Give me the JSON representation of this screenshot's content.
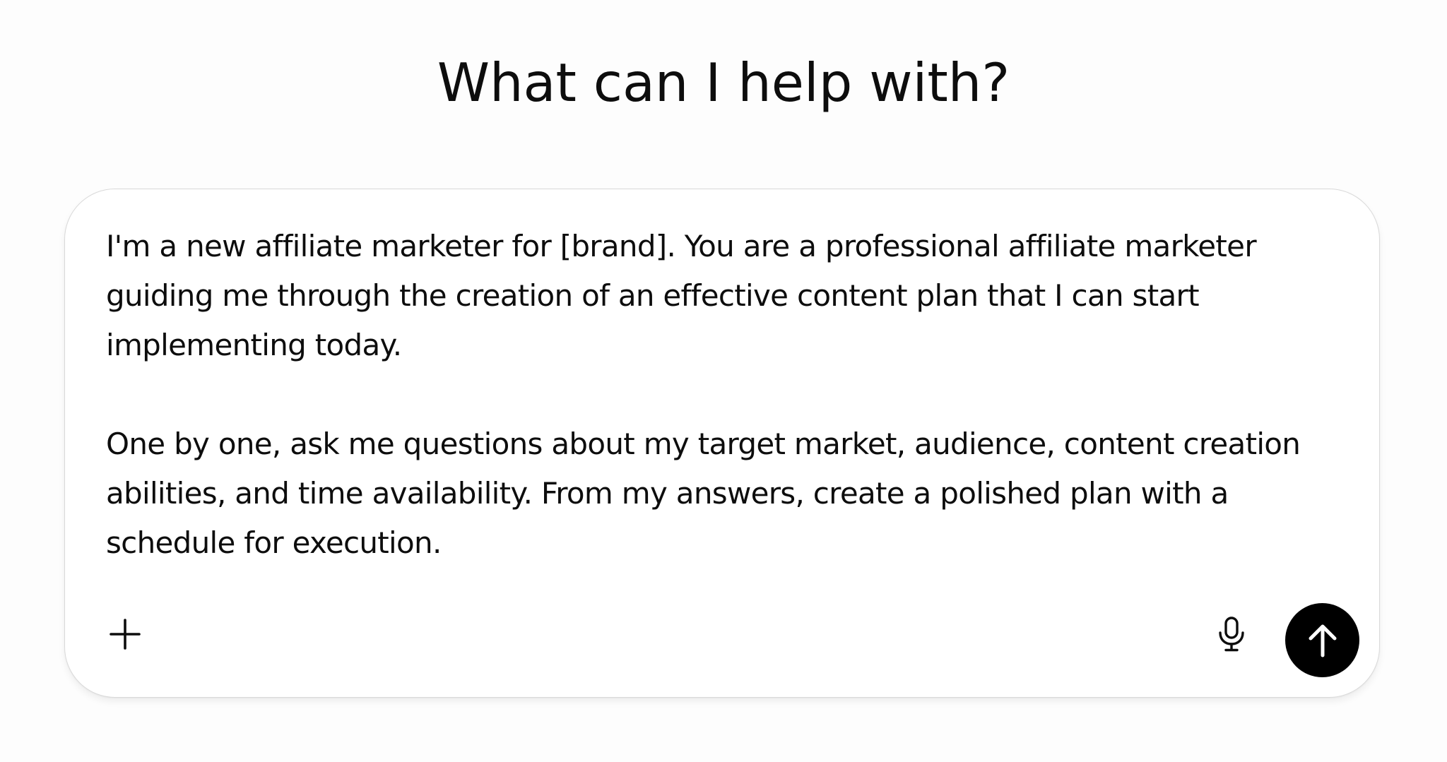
{
  "header": {
    "title": "What can I help with?"
  },
  "composer": {
    "paragraphs": [
      "I'm a new affiliate marketer for [brand]. You are a professional affiliate marketer guiding me through the creation of an effective content plan that I can start implementing today.",
      "One by one, ask me questions about my target market, audience, content creation abilities, and time availability. From my answers, create a polished plan with a schedule for execution."
    ],
    "buttons": {
      "add_icon": "plus-icon",
      "mic_icon": "microphone-icon",
      "send_icon": "arrow-up-icon"
    }
  },
  "colors": {
    "background": "#fdfdfd",
    "card": "#ffffff",
    "border": "#d9d9d9",
    "text": "#0d0d0d",
    "send_button": "#000000"
  }
}
